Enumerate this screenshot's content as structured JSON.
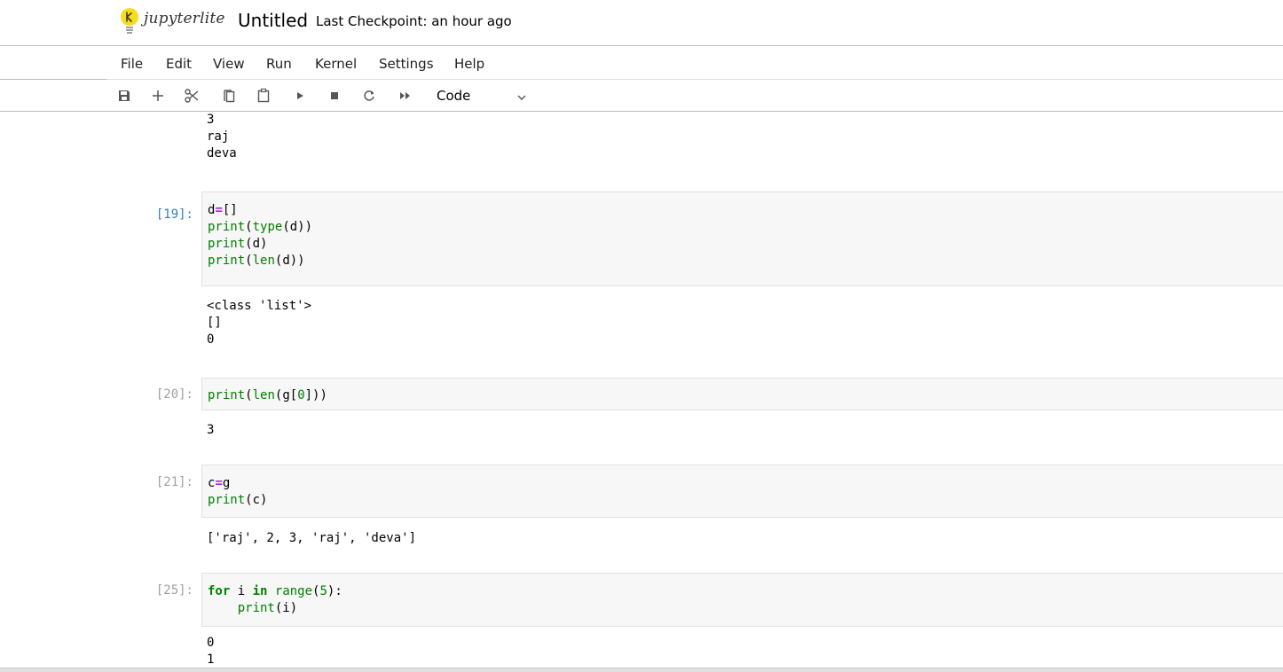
{
  "header": {
    "logo_text": "jupyterlite",
    "notebook_title": "Untitled",
    "checkpoint": "Last Checkpoint: an hour ago"
  },
  "menu": [
    "File",
    "Edit",
    "View",
    "Run",
    "Kernel",
    "Settings",
    "Help"
  ],
  "toolbar": {
    "buttons": [
      "save-icon",
      "add-cell-icon",
      "cut-icon",
      "copy-icon",
      "paste-icon",
      "run-icon",
      "stop-icon",
      "restart-icon",
      "run-all-icon"
    ],
    "cell_type": "Code"
  },
  "cells": {
    "top_output": [
      "3",
      "raj",
      "deva"
    ],
    "c19": {
      "prompt": "[19]:",
      "output": [
        "<class 'list'>",
        "[]",
        "0"
      ]
    },
    "c20": {
      "prompt": "[20]:",
      "output": [
        "3"
      ]
    },
    "c21": {
      "prompt": "[21]:",
      "output": [
        "['raj', 2, 3, 'raj', 'deva']"
      ]
    },
    "c25": {
      "prompt": "[25]:",
      "output": [
        "0",
        "1"
      ]
    }
  },
  "colors": {
    "active_prompt": "#307fc1",
    "inactive_prompt": "#a0a0a0",
    "keyword_green": "#008000",
    "operator_purple": "#aa22ff",
    "logo_yellow": "#f7dc1e"
  }
}
